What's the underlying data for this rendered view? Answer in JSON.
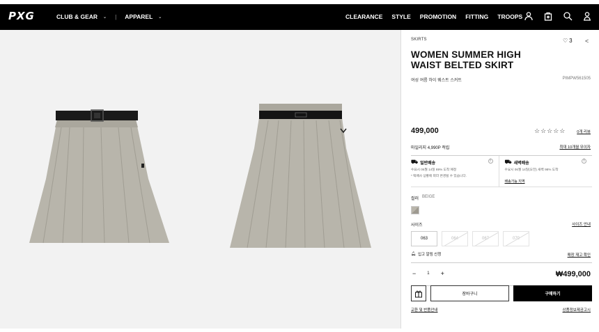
{
  "header": {
    "logo": "PXG",
    "nav_left": [
      {
        "label": "CLUB & GEAR"
      },
      {
        "label": "APPAREL"
      }
    ],
    "nav_right": [
      "CLEARANCE",
      "STYLE",
      "PROMOTION",
      "FITTING",
      "TROOPS"
    ],
    "icons": [
      "user-icon",
      "bag-icon",
      "search-icon",
      "account-icon"
    ]
  },
  "product": {
    "category": "SKIRTS",
    "likes": "3",
    "title": "WOMEN SUMMER HIGH WAIST BELTED SKIRT",
    "subtitle": "여성 여름 하이 웨스트 스커트",
    "code": "PIMPW561505",
    "price": "499,000",
    "review_link": "0개 리뷰",
    "points": "마일리지 4,990P 적립",
    "points_link": "최대 10개월 무이자",
    "delivery": {
      "standard": {
        "title": "일반배송",
        "line1": "수요시 06월 14일 89% 도착 예정",
        "line2": "* 택배사 상황에 따라 변경될 수 있습니다."
      },
      "dawn": {
        "title": "새벽배송",
        "line1": "수요시 06월 14일(오전) 새벽 98% 도착",
        "link": "배송가능 지역"
      }
    },
    "color_label": "컬러",
    "color_value": "BEIGE",
    "size_label": "사이즈",
    "size_guide": "사이즈 안내",
    "sizes": [
      {
        "label": "063",
        "available": true
      },
      {
        "label": "064",
        "available": false
      },
      {
        "label": "067",
        "available": false
      },
      {
        "label": "070",
        "available": false
      }
    ],
    "restock_text": "입고 알림 신청",
    "restock_link": "매장 재고 확인",
    "quantity": "1",
    "total": "₩499,000",
    "cart_label": "장바구니",
    "buy_label": "구매하기",
    "footer_left": "교환 및 반품안내",
    "footer_right": "상품정보제공고시"
  },
  "colors": {
    "header_bg": "#000000",
    "skirt": "#b8b5ab",
    "gallery_bg": "#f2f2f2"
  }
}
